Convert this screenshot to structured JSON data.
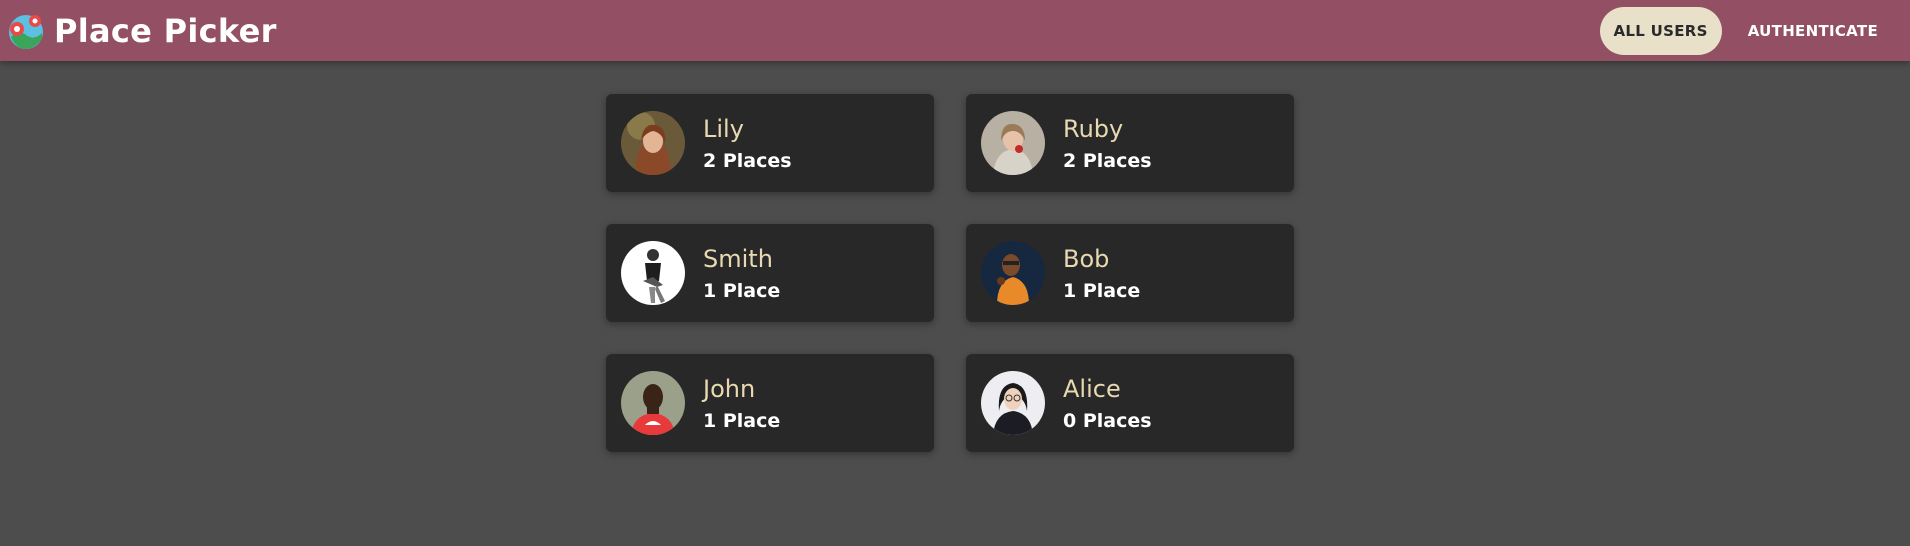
{
  "app": {
    "title": "Place Picker"
  },
  "nav": {
    "all_users": "ALL USERS",
    "authenticate": "AUTHENTICATE"
  },
  "users": [
    {
      "name": "Lily",
      "places": "2 Places"
    },
    {
      "name": "Ruby",
      "places": "2 Places"
    },
    {
      "name": "Smith",
      "places": "1 Place"
    },
    {
      "name": "Bob",
      "places": "1 Place"
    },
    {
      "name": "John",
      "places": "1 Place"
    },
    {
      "name": "Alice",
      "places": "0 Places"
    }
  ],
  "colors": {
    "header": "#935065",
    "background": "#4d4d4d",
    "card": "#282828",
    "name_text": "#e8d9b0",
    "active_nav": "#e8e0c9"
  }
}
